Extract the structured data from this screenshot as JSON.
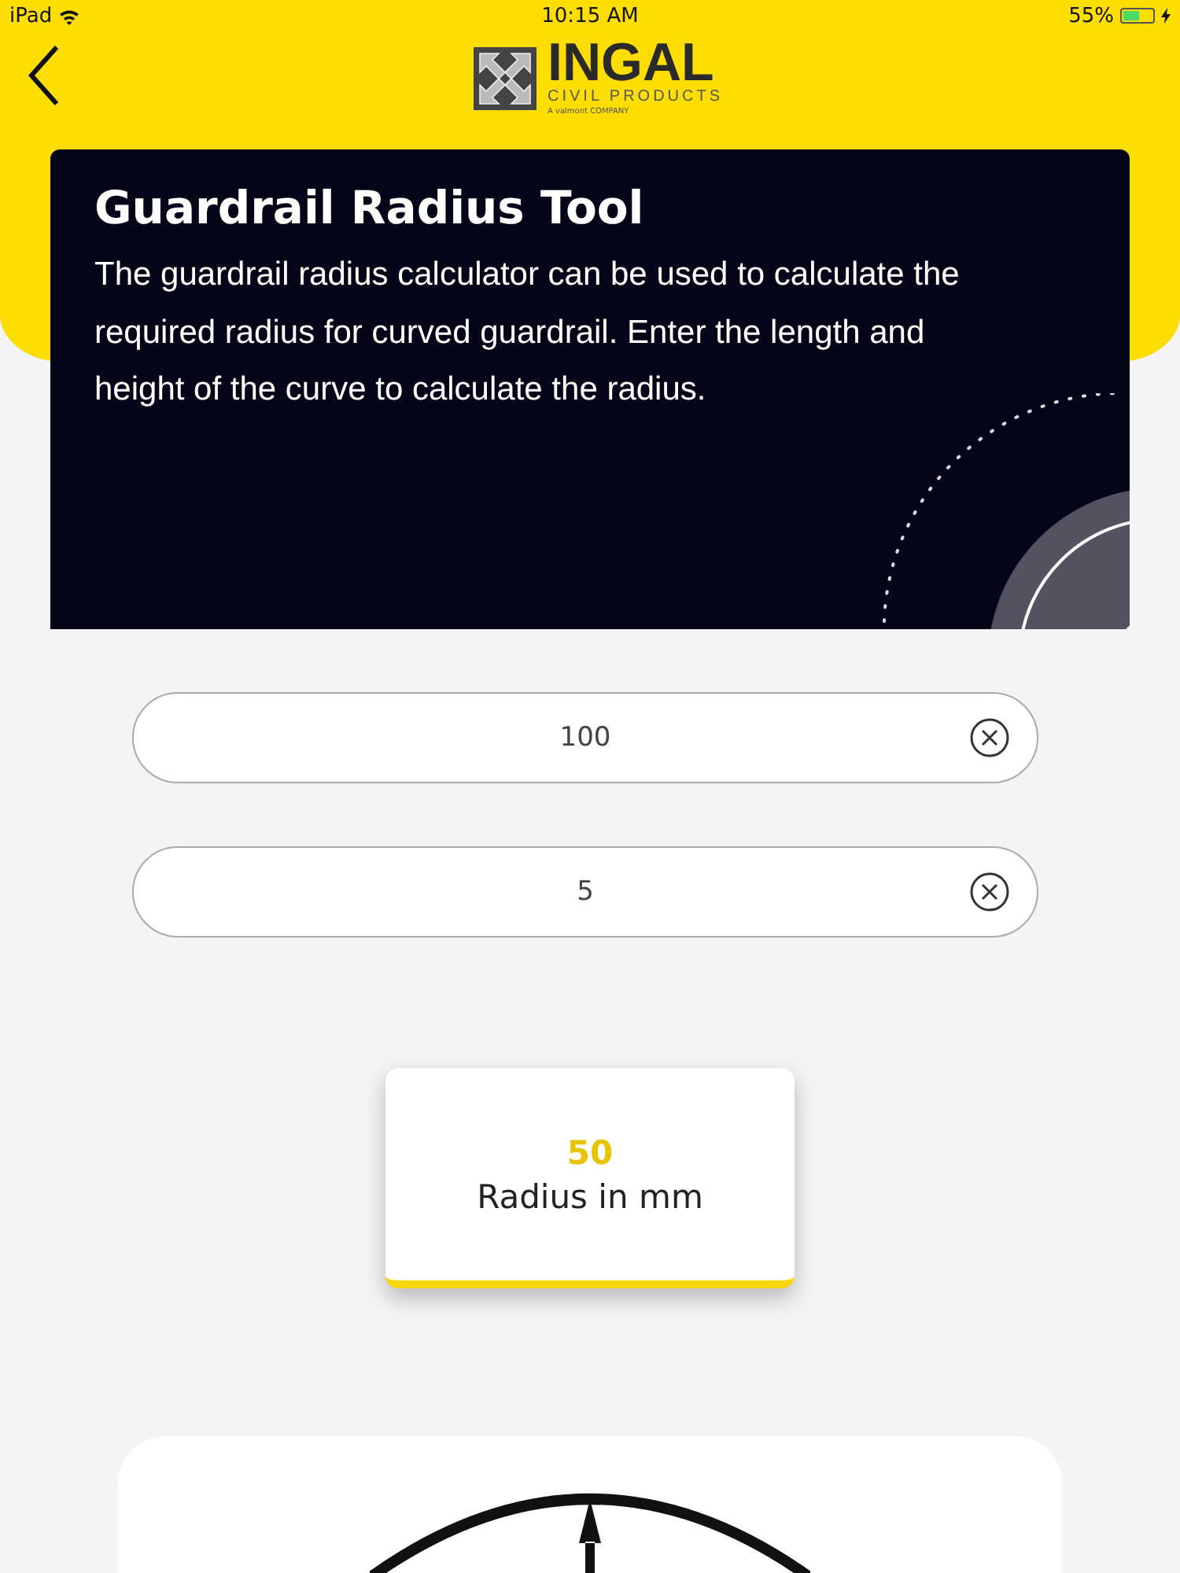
{
  "status_bar": {
    "device": "iPad",
    "time": "10:15 AM",
    "battery": "55%"
  },
  "header": {
    "logo": {
      "name": "INGAL",
      "subtitle": "CIVIL PRODUCTS",
      "tagline": "A valmont COMPANY"
    }
  },
  "intro": {
    "title": "Guardrail Radius Tool",
    "description": "The guardrail radius calculator can be used to calculate the required radius for curved guardrail. Enter the length and height of the curve to calculate the radius."
  },
  "fields": [
    {
      "value": "100"
    },
    {
      "value": "5"
    }
  ],
  "result": {
    "value": "50",
    "label": "Radius in mm"
  }
}
